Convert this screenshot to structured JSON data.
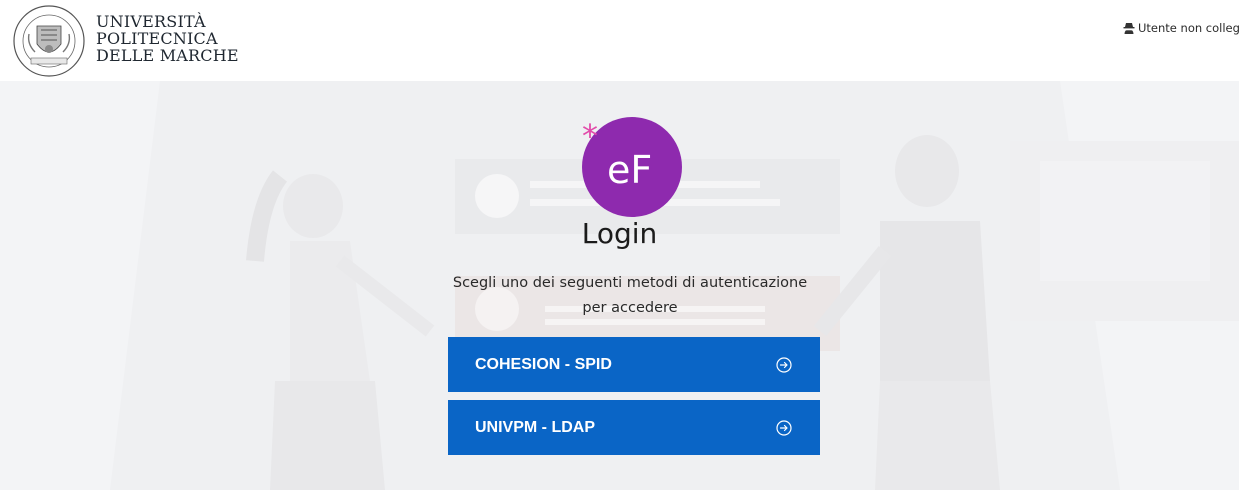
{
  "header": {
    "university_name_lines": [
      "UNIVERSITÀ",
      "POLITECNICA",
      "DELLE MARCHE"
    ],
    "seal_text": "UNIVERSITÀ POLITECNICA DELLE MARCHE",
    "user_status_text": "Utente non collegato",
    "user_status_icon": "incognito-user-icon"
  },
  "main": {
    "app_logo_text": "eF",
    "app_logo_asterisk": "*",
    "title": "Login",
    "subtitle_line1": "Scegli uno dei seguenti metodi di autenticazione",
    "subtitle_line2": "per accedere",
    "auth_methods": [
      {
        "label": "COHESION - SPID",
        "icon": "arrow-circle-right-icon"
      },
      {
        "label": "UNIVPM - LDAP",
        "icon": "arrow-circle-right-icon"
      }
    ]
  },
  "colors": {
    "primary_button": "#0a65c6",
    "ef_logo_purple": "#8e2aae",
    "background": "#f3f4f6"
  }
}
